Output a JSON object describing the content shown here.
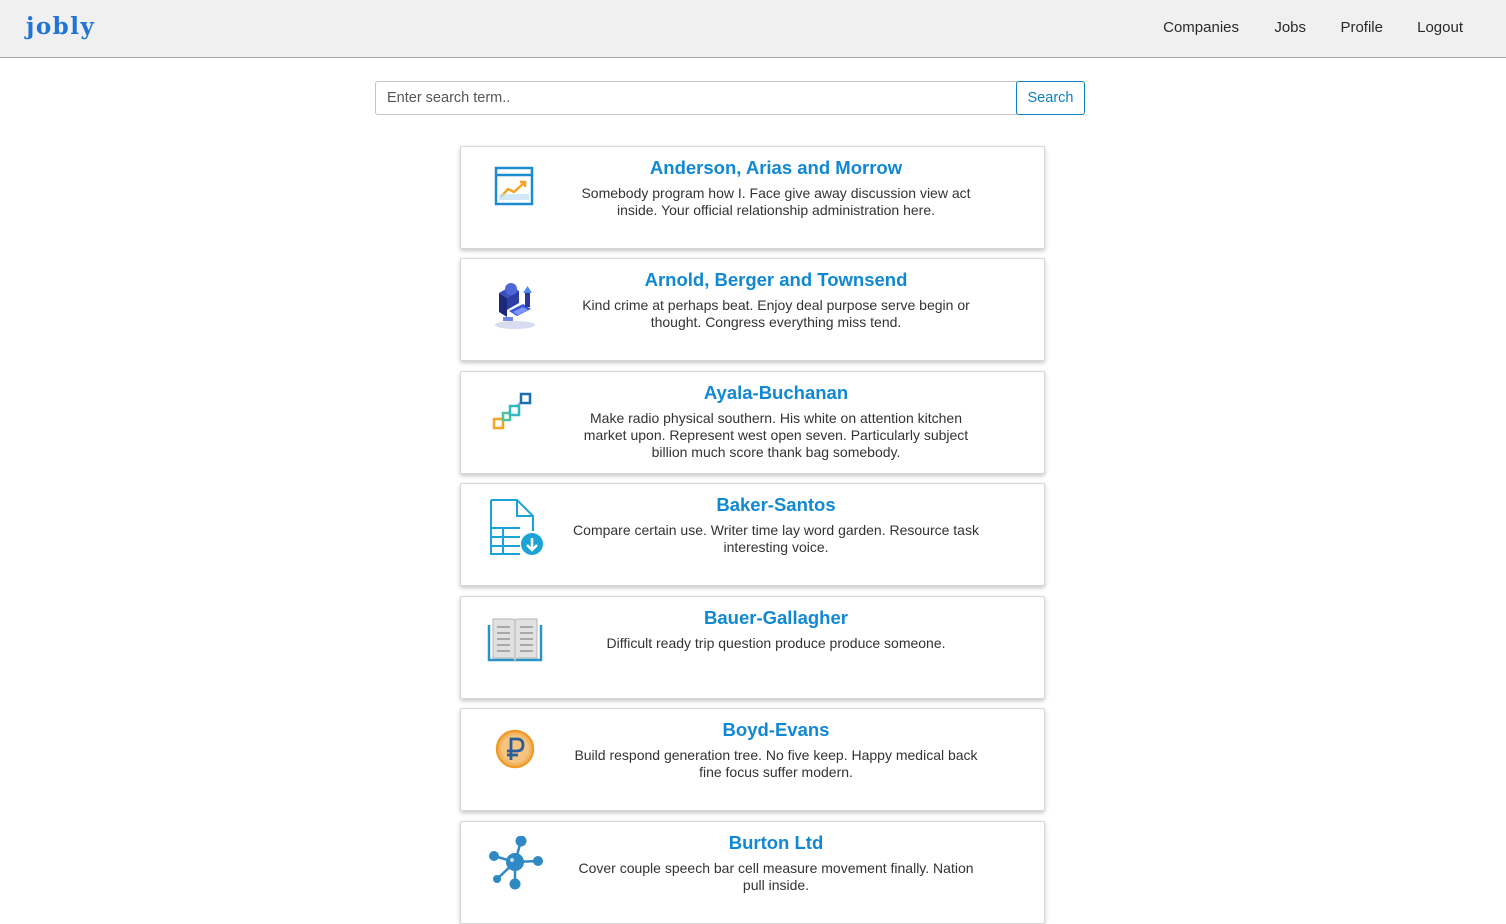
{
  "navbar": {
    "brand": "jobly",
    "links": [
      "Companies",
      "Jobs",
      "Profile",
      "Logout"
    ]
  },
  "search": {
    "placeholder": "Enter search term..",
    "button_label": "Search"
  },
  "companies": [
    {
      "name": "Anderson, Arias and Morrow",
      "description": "Somebody program how I. Face give away discussion view act inside. Your official relationship administration here.",
      "logo_icon": "chart-window-icon"
    },
    {
      "name": "Arnold, Berger and Townsend",
      "description": "Kind crime at perhaps beat. Enjoy deal purpose serve begin or thought. Congress everything miss tend.",
      "logo_icon": "isometric-tech-icon"
    },
    {
      "name": "Ayala-Buchanan",
      "description": "Make radio physical southern. His white on attention kitchen market upon. Represent west open seven. Particularly subject billion much score thank bag somebody.",
      "logo_icon": "connected-squares-icon"
    },
    {
      "name": "Baker-Santos",
      "description": "Compare certain use. Writer time lay word garden. Resource task interesting voice.",
      "logo_icon": "document-download-icon"
    },
    {
      "name": "Bauer-Gallagher",
      "description": "Difficult ready trip question produce produce someone.",
      "logo_icon": "open-book-icon"
    },
    {
      "name": "Boyd-Evans",
      "description": "Build respond generation tree. No five keep. Happy medical back fine focus suffer modern.",
      "logo_icon": "ruble-coin-icon"
    },
    {
      "name": "Burton Ltd",
      "description": "Cover couple speech bar cell measure movement finally. Nation pull inside.",
      "logo_icon": "molecule-network-icon"
    }
  ],
  "colors": {
    "brand": "#1f74d4",
    "accent": "#1188d4",
    "navbar_bg": "#f0f0f0"
  }
}
